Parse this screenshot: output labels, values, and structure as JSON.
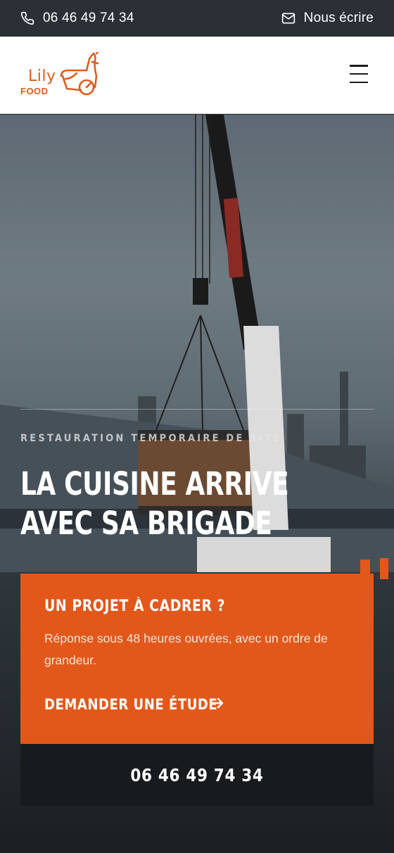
{
  "topbar": {
    "phone": "06 46 49 74 34",
    "email_label": "Nous écrire",
    "phone_icon": "phone-icon",
    "email_icon": "envelope-icon"
  },
  "header": {
    "logo_line1": "Lily",
    "logo_line2": "FOOD",
    "menu_icon": "hamburger-menu-icon"
  },
  "hero": {
    "eyebrow": "RESTAURATION TEMPORAIRE DE SITE",
    "headline_line1": "LA CUISINE ARRIVE",
    "headline_line2": "AVEC SA BRIGADE"
  },
  "cta": {
    "title": "UN PROJET À CADRER ?",
    "text": "Réponse sous 48 heures ouvrées, avec un ordre de grandeur.",
    "link_label": "DEMANDER UNE ÉTUDE",
    "link_icon": "arrow-right-icon"
  },
  "phone_bar": {
    "number": "06 46 49 74 34"
  },
  "colors": {
    "brand_orange": "#e2581b",
    "topbar_bg": "#2b3036",
    "phone_bar_bg": "#181b1e"
  }
}
